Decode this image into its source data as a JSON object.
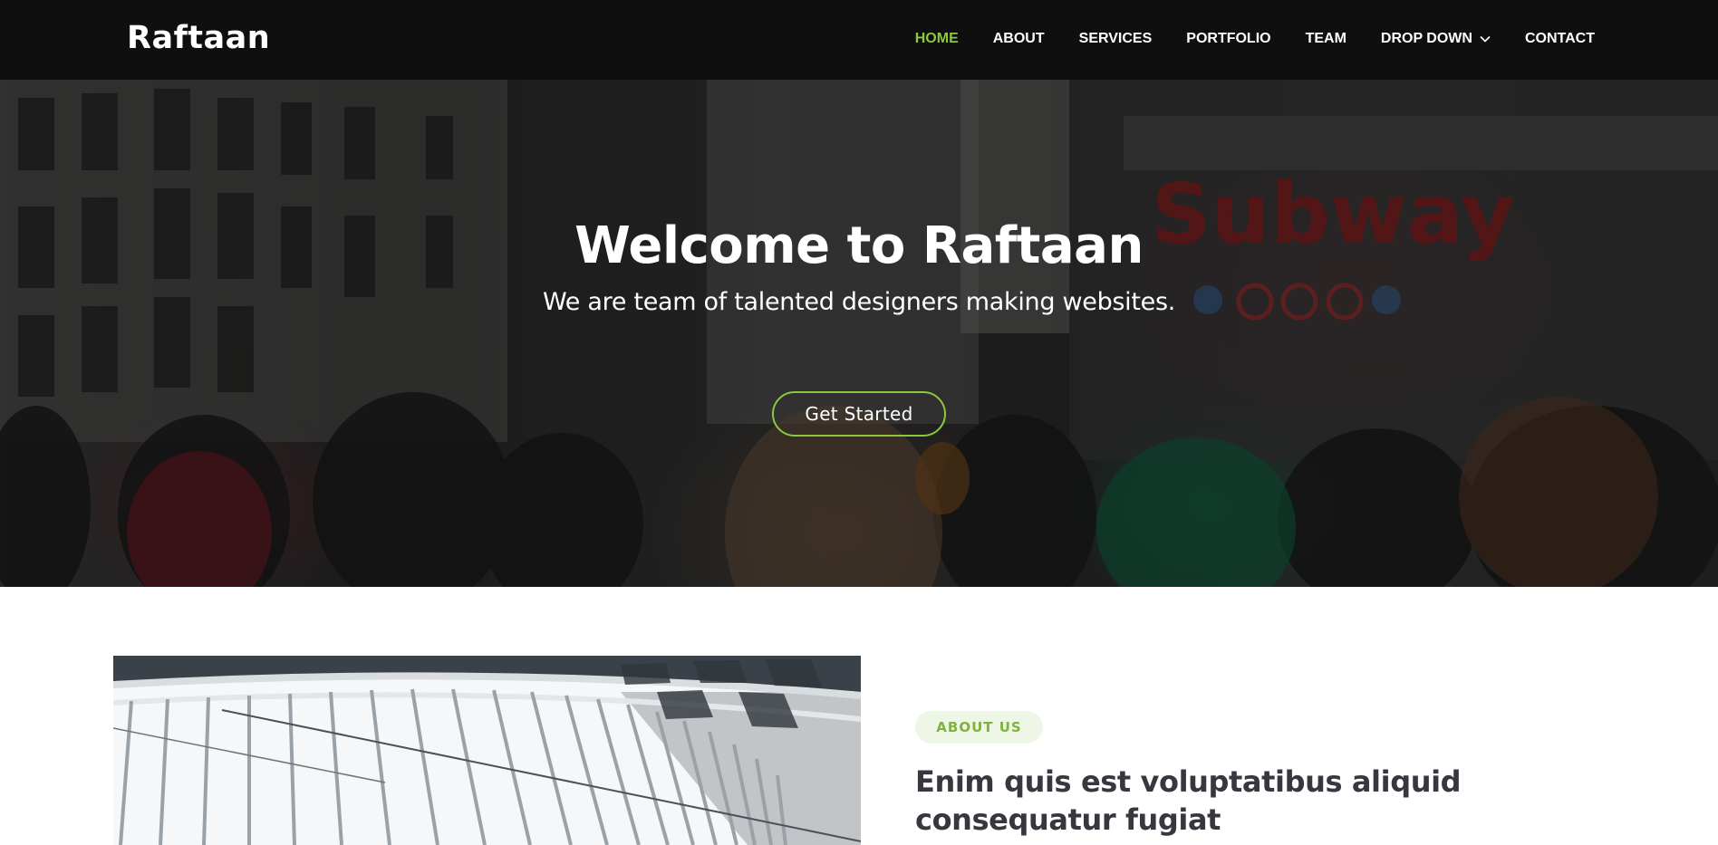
{
  "brand": {
    "name": "Raftaan"
  },
  "nav": {
    "items": [
      {
        "label": "HOME",
        "active": true
      },
      {
        "label": "ABOUT"
      },
      {
        "label": "SERVICES"
      },
      {
        "label": "PORTFOLIO"
      },
      {
        "label": "TEAM"
      },
      {
        "label": "DROP DOWN",
        "icon": "chevron-down-icon"
      },
      {
        "label": "CONTACT"
      }
    ]
  },
  "hero": {
    "title": "Welcome to Raftaan",
    "subtitle": "We are team of talented designers making websites.",
    "cta_label": "Get Started",
    "sign_text": "Subway"
  },
  "about": {
    "tag": "ABOUT US",
    "heading": "Enim quis est voluptatibus aliquid consequatur fugiat"
  },
  "colors": {
    "accent": "#8dc63f",
    "header_bg": "#0f0f0f",
    "heading_text": "#37373f",
    "tag_bg": "#eef6e5"
  }
}
